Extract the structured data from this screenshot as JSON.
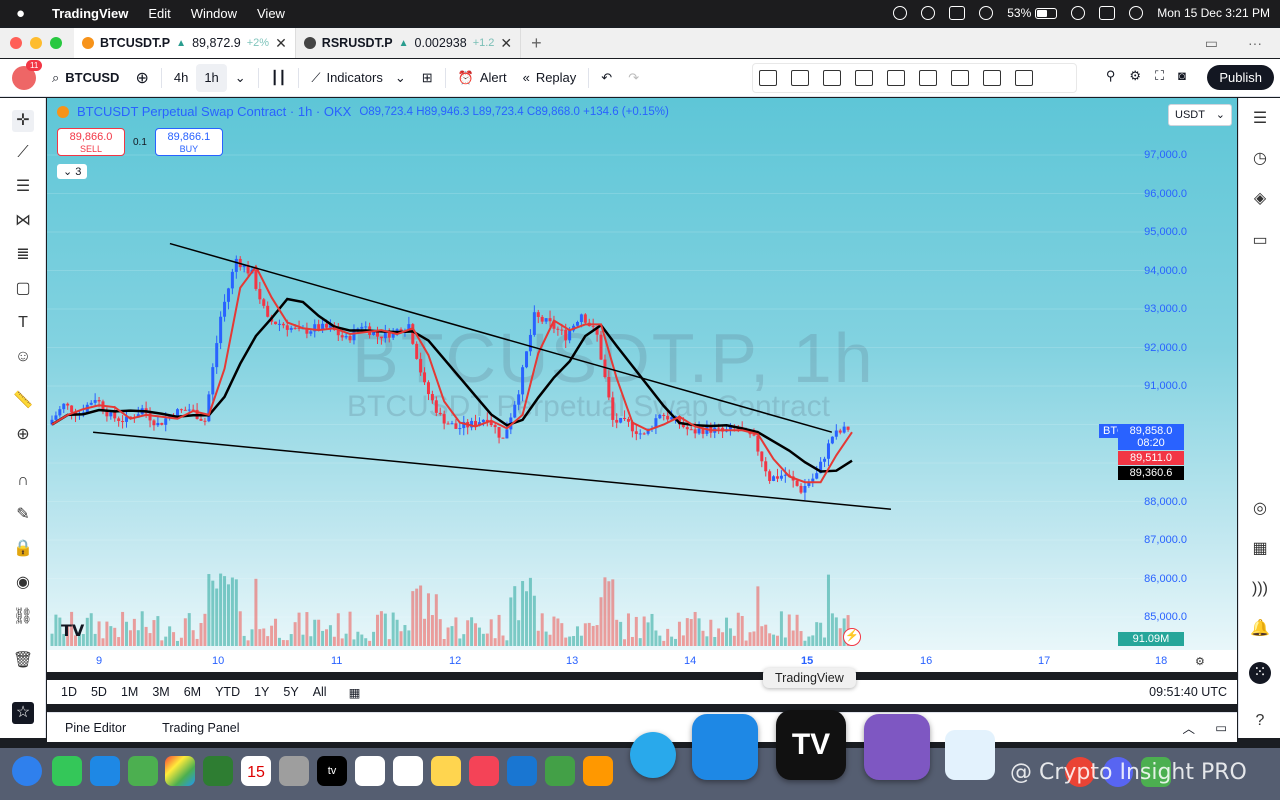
{
  "menubar": {
    "app": "TradingView",
    "items": [
      "Edit",
      "Window",
      "View"
    ],
    "battery": "53%",
    "datetime": "Mon 15 Dec  3:21 PM"
  },
  "tabs": [
    {
      "symbol": "BTCUSDT.P",
      "price": "89,872.9",
      "change": "+2%"
    },
    {
      "symbol": "RSRUSDT.P",
      "price": "0.002938",
      "change": "+1.2"
    }
  ],
  "toolbar": {
    "notifications": "11",
    "symbol": "BTCUSD",
    "interval_4h": "4h",
    "interval_1h": "1h",
    "indicators": "Indicators",
    "alert": "Alert",
    "replay": "Replay",
    "publish": "Publish"
  },
  "legend": {
    "title": "BTCUSDT Perpetual Swap Contract · 1h · OKX",
    "ohlc": "O89,723.4  H89,946.3  L89,723.4  C89,868.0  +134.6 (+0.15%)",
    "sell_price": "89,866.0",
    "sell_label": "SELL",
    "buy_price": "89,866.1",
    "buy_label": "BUY",
    "qty": "0.1",
    "collapsed_count": "3"
  },
  "currency_select": "USDT",
  "watermark": {
    "symbol": "BTCUSDT.P, 1h",
    "desc": "BTCUSDT Perpetual Swap Contract"
  },
  "price_axis": [
    "97,000.0",
    "96,000.0",
    "95,000.0",
    "94,000.0",
    "93,000.0",
    "92,000.0",
    "91,000.0",
    "88,000.0",
    "87,000.0",
    "86,000.0",
    "85,000.0"
  ],
  "price_tags": {
    "symbol": "BTCUSDT.P",
    "last": "89,858.0",
    "countdown": "08:20",
    "ma_red": "89,511.0",
    "ma_black": "89,360.6",
    "volume": "91.09M"
  },
  "time_axis": [
    "9",
    "10",
    "11",
    "12",
    "13",
    "14",
    "15",
    "16",
    "17",
    "18"
  ],
  "ranges": [
    "1D",
    "5D",
    "1M",
    "3M",
    "6M",
    "YTD",
    "1Y",
    "5Y",
    "All"
  ],
  "clock": "09:51:40 UTC",
  "bottom_tabs": [
    "Pine Editor",
    "Trading Panel"
  ],
  "dock_tooltip": "TradingView",
  "dock_calendar_day": "15",
  "dock_tv_label": "tv",
  "overlay_watermark": "@ Crypto Insight PRO",
  "chart_data": {
    "type": "candlestick",
    "timeframe": "1h",
    "ylim": [
      84500,
      97500
    ],
    "close_series": [
      90000,
      90500,
      90300,
      90700,
      90200,
      90100,
      90400,
      90000,
      90300,
      90400,
      90100,
      92800,
      94300,
      93900,
      92700,
      92600,
      92400,
      92500,
      92500,
      92200,
      92600,
      92300,
      92400,
      92600,
      91000,
      90200,
      89900,
      90000,
      90200,
      89600,
      90900,
      92800,
      92600,
      92300,
      92900,
      92300,
      90100,
      90000,
      89700,
      90300,
      90100,
      89800,
      89900,
      89800,
      89900,
      89600,
      88600,
      88700,
      88300,
      88700,
      89700,
      89900
    ],
    "ma_fast_last": 89511.0,
    "ma_slow_last": 89360.6,
    "trendlines": [
      {
        "name": "upper",
        "from": [
          9.6,
          94700
        ],
        "to": [
          15.2,
          89800
        ]
      },
      {
        "name": "lower",
        "from": [
          8.95,
          89800
        ],
        "to": [
          15.7,
          87800
        ]
      }
    ]
  }
}
